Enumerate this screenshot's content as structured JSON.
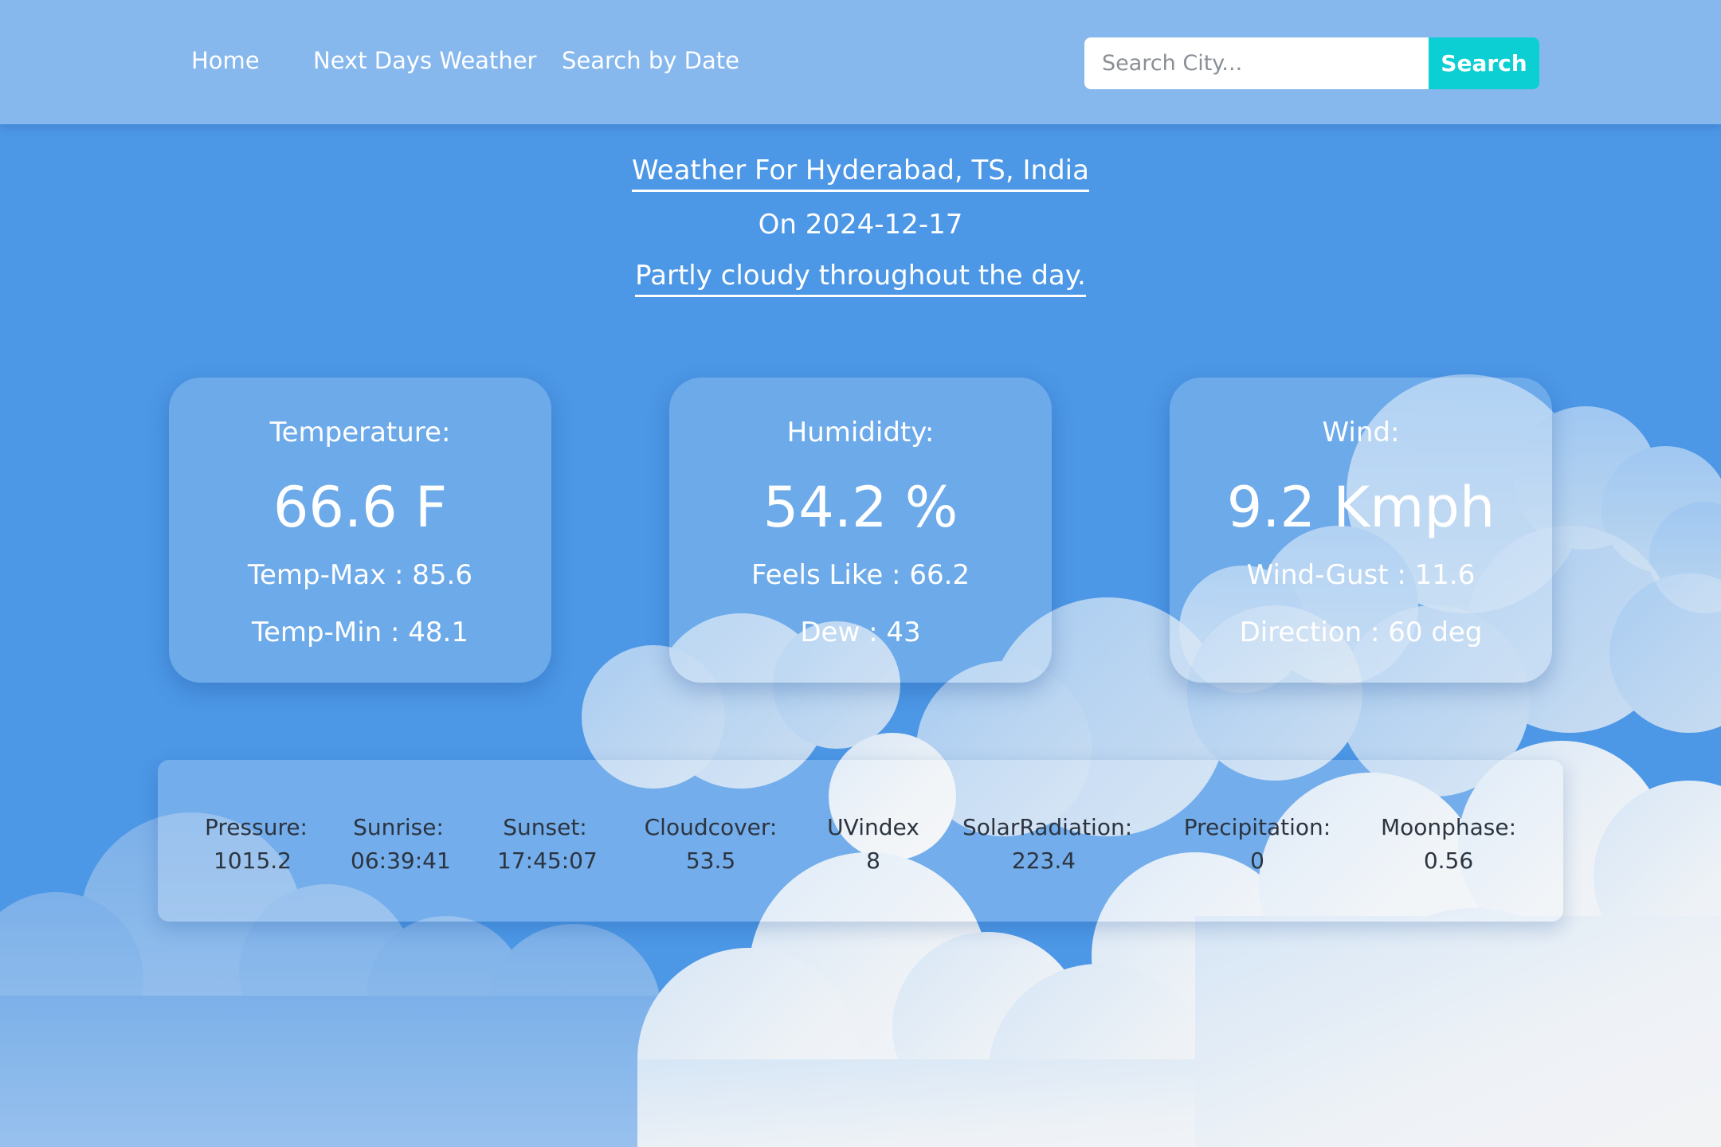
{
  "nav": {
    "links": [
      {
        "label": "Home"
      },
      {
        "label": "Next Days Weather"
      },
      {
        "label": "Search by Date"
      }
    ]
  },
  "search": {
    "placeholder": "Search City...",
    "value": "",
    "button_label": "Search"
  },
  "heading": {
    "location": "Weather For Hyderabad, TS, India",
    "date": "On 2024-12-17",
    "description": "Partly cloudy throughout the day."
  },
  "cards": {
    "temperature": {
      "title": "Temperature:",
      "main": "66.6 F",
      "line1": "Temp-Max : 85.6",
      "line2": "Temp-Min : 48.1"
    },
    "humidity": {
      "title": "Humididty:",
      "main": "54.2 %",
      "line1": "Feels Like : 66.2",
      "line2": "Dew : 43"
    },
    "wind": {
      "title": "Wind:",
      "main": "9.2 Kmph",
      "line1": "Wind-Gust : 11.6",
      "line2": "Direction : 60 deg"
    }
  },
  "stats": [
    {
      "label": "Pressure:",
      "value": "1015.2"
    },
    {
      "label": "Sunrise:",
      "value": "06:39:41"
    },
    {
      "label": "Sunset:",
      "value": "17:45:07"
    },
    {
      "label": "Cloudcover:",
      "value": "53.5"
    },
    {
      "label": "UVindex",
      "value": "8"
    },
    {
      "label": "SolarRadiation:",
      "value": "223.4"
    },
    {
      "label": "Precipitation:",
      "value": "0"
    },
    {
      "label": "Moonphase:",
      "value": "0.56"
    }
  ],
  "colors": {
    "background": "#4c97e6",
    "navbar": "#86b8ee",
    "search_button": "#0bcfd2",
    "stats_text": "#2c3440"
  }
}
